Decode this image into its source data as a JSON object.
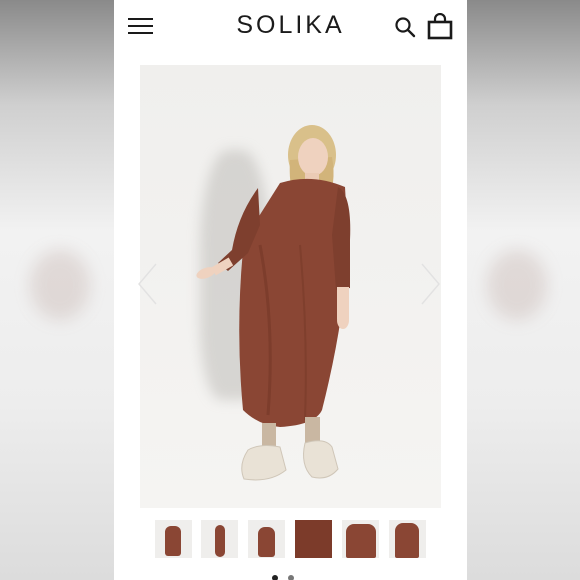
{
  "brand": {
    "name": "SOLIKA",
    "text_color": "#1b1b1b"
  },
  "header": {
    "menu_icon": "hamburger-menu-icon",
    "search_icon": "search-icon",
    "cart_icon": "shopping-bag-icon"
  },
  "gallery": {
    "prev_icon": "chevron-left-icon",
    "next_icon": "chevron-right-icon",
    "dress_color": "#8a4634",
    "thumbnail_count": 6,
    "selected_thumbnail": 1
  }
}
